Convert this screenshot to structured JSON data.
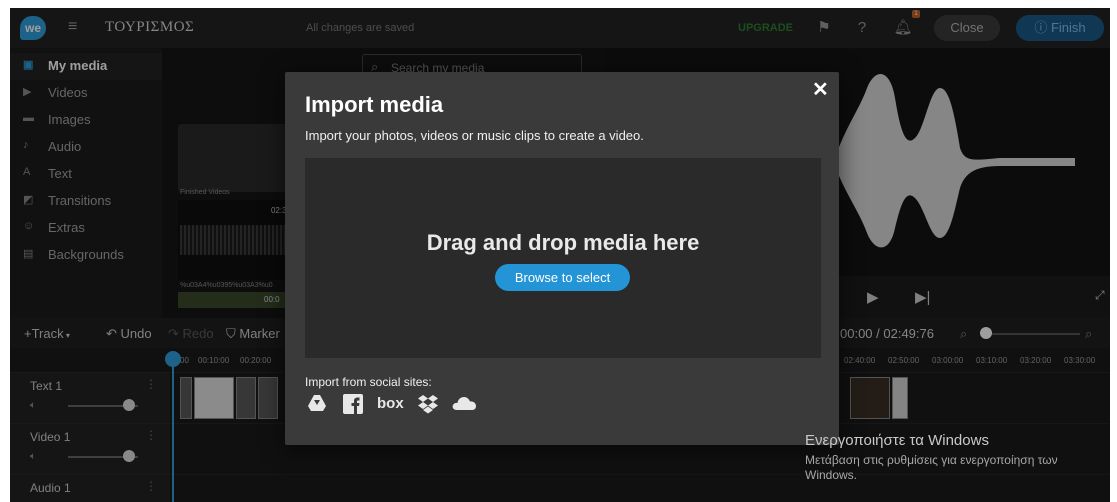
{
  "topbar": {
    "logo_text": "we",
    "project_title": "ΤΟΥΡΙΣΜΟΣ",
    "save_status": "All changes are saved",
    "upgrade_label": "UPGRADE",
    "notification_count": "1",
    "close_label": "Close",
    "finish_label": "Finish"
  },
  "sidebar": {
    "items": [
      {
        "label": "My media",
        "icon": "folder-icon"
      },
      {
        "label": "Videos",
        "icon": "video-icon"
      },
      {
        "label": "Images",
        "icon": "image-icon"
      },
      {
        "label": "Audio",
        "icon": "music-note-icon"
      },
      {
        "label": "Text",
        "icon": "text-icon"
      },
      {
        "label": "Transitions",
        "icon": "transition-icon"
      },
      {
        "label": "Extras",
        "icon": "smiley-icon"
      },
      {
        "label": "Backgrounds",
        "icon": "background-icon"
      }
    ]
  },
  "media": {
    "search_placeholder": "Search my media",
    "folder_label": "Finished Videos",
    "thumb_duration": "02:32",
    "thumb_filename": "%u03A4%u0395%u03A3%u0",
    "thumb2_duration": "00:0"
  },
  "toolbar": {
    "track_label": "Track",
    "undo_label": "Undo",
    "redo_label": "Redo",
    "marker_label": "Marker",
    "timecode": "00:00 / 02:49:76"
  },
  "ruler": {
    "left_ticks": [
      "00",
      "00:10:00",
      "00:20:00"
    ],
    "right_ticks": [
      "02:40:00",
      "02:50:00",
      "03:00:00",
      "03:10:00",
      "03:20:00",
      "03:30:00"
    ]
  },
  "tracks": [
    {
      "name": "Text 1"
    },
    {
      "name": "Video 1"
    },
    {
      "name": "Audio 1"
    }
  ],
  "modal": {
    "title": "Import media",
    "subtitle": "Import your photos, videos or music clips to create a video.",
    "drop_text": "Drag and drop media here",
    "browse_label": "Browse to select",
    "social_label": "Import from social sites:",
    "social_sites": [
      "google-drive-icon",
      "facebook-icon",
      "box-icon",
      "dropbox-icon",
      "onedrive-icon"
    ]
  },
  "watermark": {
    "line1": "Ενεργοποιήστε τα Windows",
    "line2": "Μετάβαση στις ρυθμίσεις για ενεργοποίηση των Windows."
  },
  "colors": {
    "accent": "#2394d6",
    "modal_bg": "#3a3a3a",
    "app_bg": "#1c1c1c",
    "upgrade": "#2e7d32"
  }
}
